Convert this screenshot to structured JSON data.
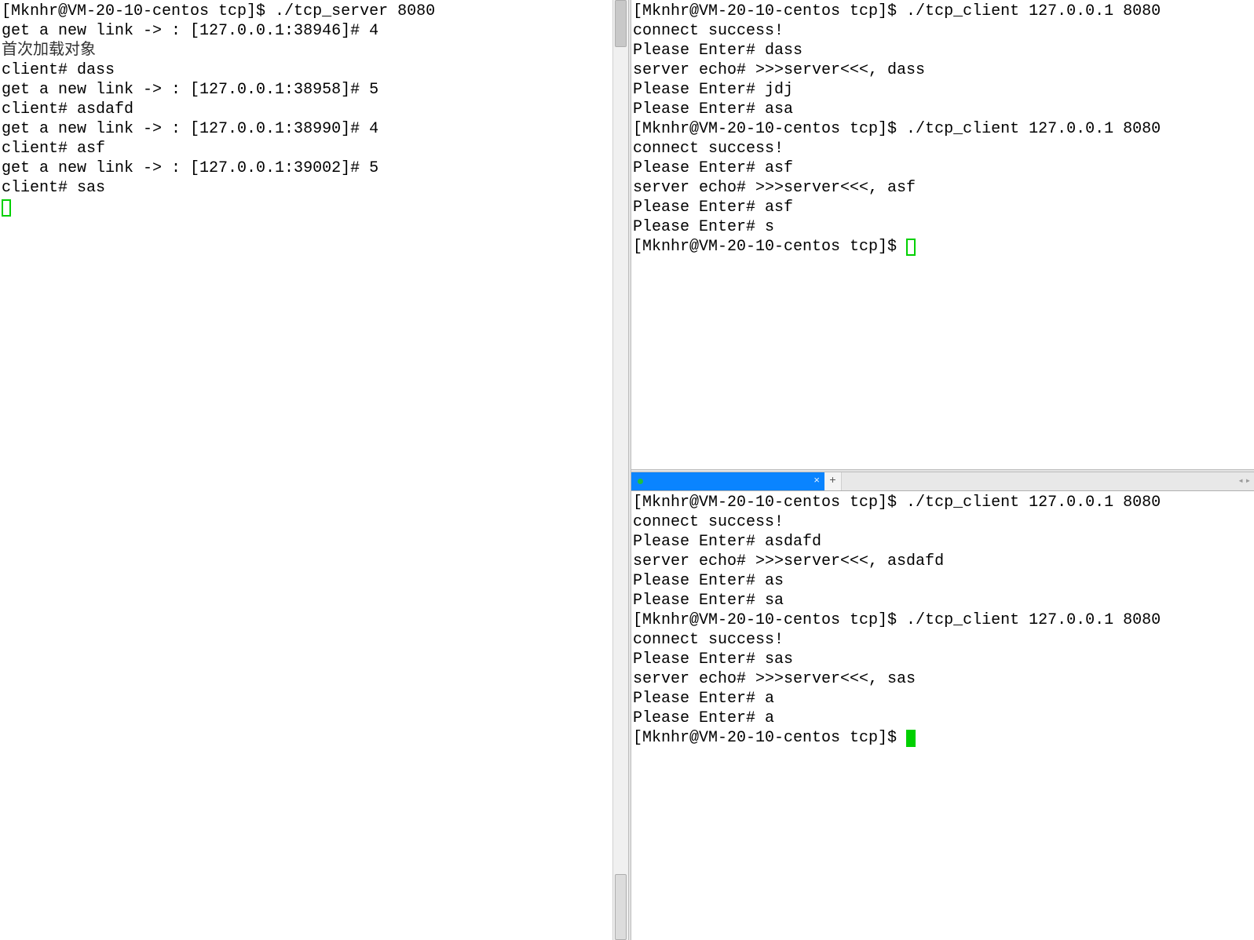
{
  "left_pane": {
    "lines": [
      "[Mknhr@VM-20-10-centos tcp]$ ./tcp_server 8080",
      "get a new link -> : [127.0.0.1:38946]# 4",
      "首次加载对象",
      "client# dass",
      "",
      "get a new link -> : [127.0.0.1:38958]# 5",
      "client# asdafd",
      "",
      "get a new link -> : [127.0.0.1:38990]# 4",
      "client# asf",
      "",
      "get a new link -> : [127.0.0.1:39002]# 5",
      "client# sas",
      ""
    ],
    "cursor": "outline"
  },
  "right_top": {
    "lines": [
      "[Mknhr@VM-20-10-centos tcp]$ ./tcp_client 127.0.0.1 8080",
      "connect success!",
      "Please Enter# dass",
      "server echo# >>>server<<<, dass",
      "",
      "Please Enter# jdj",
      "Please Enter# asa",
      "[Mknhr@VM-20-10-centos tcp]$ ./tcp_client 127.0.0.1 8080",
      "connect success!",
      "Please Enter# asf",
      "server echo# >>>server<<<, asf",
      "",
      "Please Enter# asf",
      "Please Enter# s"
    ],
    "prompt": "[Mknhr@VM-20-10-centos tcp]$ ",
    "cursor": "outline"
  },
  "tab_bar": {
    "close_glyph": "×",
    "add_glyph": "+",
    "nav_left": "◂",
    "nav_right": "▸"
  },
  "right_bottom": {
    "lines": [
      "[Mknhr@VM-20-10-centos tcp]$ ./tcp_client 127.0.0.1 8080",
      "connect success!",
      "Please Enter# asdafd",
      "server echo# >>>server<<<, asdafd",
      "",
      "Please Enter# as",
      "Please Enter# sa",
      "[Mknhr@VM-20-10-centos tcp]$ ./tcp_client 127.0.0.1 8080",
      "connect success!",
      "Please Enter# sas",
      "server echo# >>>server<<<, sas",
      "",
      "Please Enter# a",
      "Please Enter# a"
    ],
    "prompt": "[Mknhr@VM-20-10-centos tcp]$ ",
    "cursor": "solid"
  }
}
